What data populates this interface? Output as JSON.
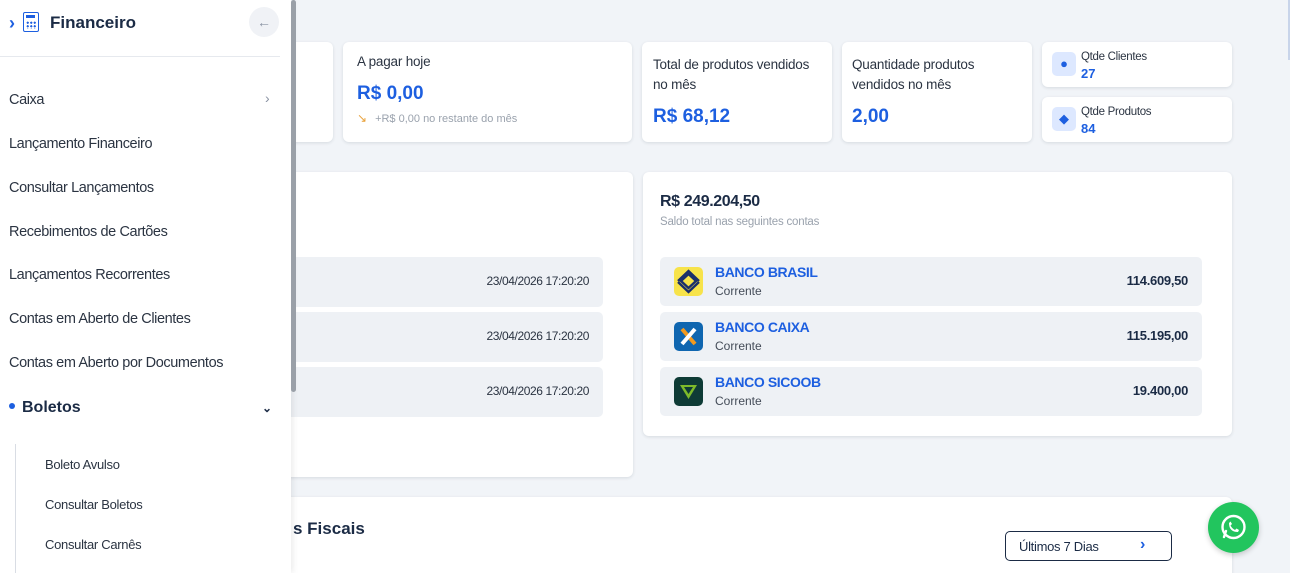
{
  "sidebar": {
    "title": "Financeiro",
    "back_icon": "arrow-left-icon",
    "items": [
      {
        "label": "Caixa",
        "has_arrow": true
      },
      {
        "label": "Lançamento Financeiro"
      },
      {
        "label": "Consultar Lançamentos"
      },
      {
        "label": "Recebimentos de Cartões"
      },
      {
        "label": "Lançamentos Recorrentes"
      },
      {
        "label": "Contas em Aberto de Clientes"
      },
      {
        "label": "Contas em Aberto por Documentos"
      }
    ],
    "active_group": "Boletos",
    "sub_items": [
      {
        "label": "Boleto Avulso"
      },
      {
        "label": "Consultar Boletos"
      },
      {
        "label": "Consultar Carnês"
      }
    ]
  },
  "cards": {
    "pagar": {
      "label": "A pagar hoje",
      "value": "R$ 0,00",
      "sub": "+R$ 0,00 no restante do mês"
    },
    "total_vendidos": {
      "label_1": "Total de produtos vendidos",
      "label_2": "no mês",
      "value": "R$ 68,12"
    },
    "qtd_vendidos": {
      "label_1": "Quantidade produtos",
      "label_2": "vendidos no mês",
      "value": "2,00"
    },
    "clientes": {
      "label": "Qtde Clientes",
      "value": "27",
      "icon": "user-icon"
    },
    "produtos": {
      "label": "Qtde Produtos",
      "value": "84",
      "icon": "box-icon"
    }
  },
  "recent": {
    "rows": [
      {
        "datetime": "23/04/2026 17:20:20"
      },
      {
        "datetime": "23/04/2026 17:20:20"
      },
      {
        "datetime": "23/04/2026 17:20:20"
      }
    ]
  },
  "balance": {
    "total": "R$ 249.204,50",
    "caption": "Saldo total nas seguintes contas",
    "banks": [
      {
        "name": "BANCO BRASIL",
        "type": "Corrente",
        "value": "114.609,50",
        "logo": "banco-brasil-logo"
      },
      {
        "name": "BANCO CAIXA",
        "type": "Corrente",
        "value": "115.195,00",
        "logo": "caixa-logo"
      },
      {
        "name": "BANCO SICOOB",
        "type": "Corrente",
        "value": "19.400,00",
        "logo": "sicoob-logo"
      }
    ]
  },
  "fiscal": {
    "title_fragment": "s Fiscais",
    "period": "Últimos 7 Dias"
  },
  "colors": {
    "accent": "#1d5fe0",
    "whatsapp": "#22c55e"
  }
}
